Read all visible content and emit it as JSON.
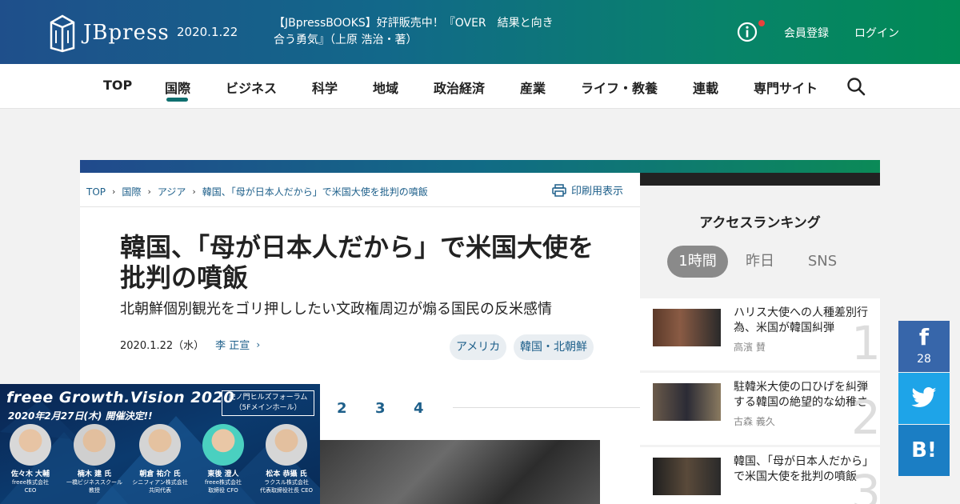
{
  "header": {
    "logo_text": "JBpress",
    "date": "2020.1.22",
    "promo": "【JBpressBOOKS】好評販売中！『OVER　結果と向き合う勇気』（上原 浩治・著）",
    "register": "会員登録",
    "login": "ログイン"
  },
  "nav": {
    "items": [
      "TOP",
      "国際",
      "ビジネス",
      "科学",
      "地域",
      "政治経済",
      "産業",
      "ライフ・教養",
      "連載",
      "専門サイト"
    ],
    "active": "国際"
  },
  "breadcrumb": [
    "TOP",
    "国際",
    "アジア",
    "韓国、「母が日本人だから」で米国大使を批判の噴飯"
  ],
  "print_label": "印刷用表示",
  "article": {
    "title": "韓国、「母が日本人だから」で米国大使を批判の噴飯",
    "subtitle": "北朝鮮個別観光をゴリ押ししたい文政権周辺が煽る国民の反米感情",
    "date": "2020.1.22（水）",
    "author": "李 正宣",
    "tags": [
      "アメリカ",
      "韓国・北朝鮮"
    ],
    "pages": [
      "2",
      "3",
      "4"
    ]
  },
  "ad": {
    "title": "freee Growth.Vision 2020",
    "date": "2020年2月27日(木) 開催決定!!",
    "venue_line1": "虎ノ門ヒルズフォーラム",
    "venue_line2": "（5Fメインホール）",
    "speakers": [
      {
        "name": "佐々木 大輔",
        "role1": "freee株式会社",
        "role2": "CEO"
      },
      {
        "name": "楠木 建 氏",
        "role1": "一橋ビジネススクール",
        "role2": "教授"
      },
      {
        "name": "朝倉 祐介 氏",
        "role1": "シニフィアン株式会社",
        "role2": "共同代表"
      },
      {
        "name": "東後 澄人",
        "role1": "freee株式会社",
        "role2": "取締役 CFO"
      },
      {
        "name": "松本 恭攝 氏",
        "role1": "ラクスル株式会社",
        "role2": "代表取締役社長 CEO"
      }
    ]
  },
  "ranking": {
    "title": "アクセスランキング",
    "tabs": [
      "1時間",
      "昨日",
      "SNS"
    ],
    "items": [
      {
        "rank": "1",
        "title": "ハリス大使への人種差別行為、米国が韓国糾弾",
        "author": "高濱 賛"
      },
      {
        "rank": "2",
        "title": "駐韓米大使の口ひげを糾弾する韓国の絶望的な幼稚さ",
        "author": "古森 義久"
      },
      {
        "rank": "3",
        "title": "韓国、「母が日本人だから」で米国大使を批判の噴飯",
        "author": ""
      }
    ]
  },
  "social": {
    "facebook_count": "28",
    "hatena_label": "B!"
  },
  "colors": {
    "header_start": "#1f4f8b",
    "header_end": "#018a55",
    "link": "#1d5f8a",
    "facebook": "#3766aa",
    "twitter": "#1ea4e8",
    "hatena": "#1b7ec4"
  }
}
